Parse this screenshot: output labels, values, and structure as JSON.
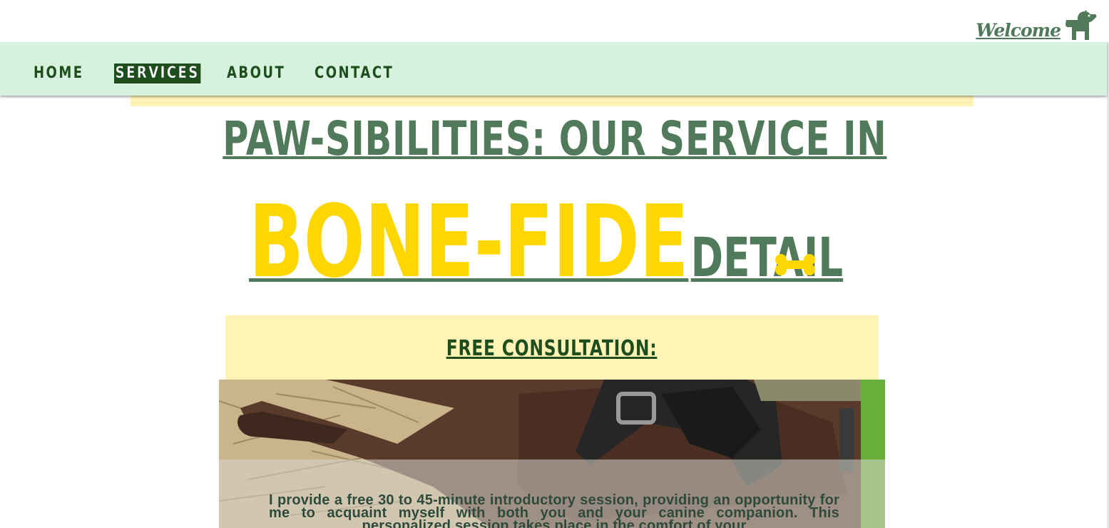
{
  "header": {
    "welcome_label": "Welcome",
    "welcome_icon": "dog-icon"
  },
  "nav": {
    "items": [
      {
        "label": "HOME",
        "active": false
      },
      {
        "label": "SERVICES",
        "active": true
      },
      {
        "label": "ABOUT",
        "active": false
      },
      {
        "label": "CONTACT",
        "active": false
      }
    ]
  },
  "hero": {
    "title_line1": "PAW-SIBILITIES: OUR SERVICE IN",
    "title_highlight": "BONE-FIDE",
    "title_rest": "DETAIL",
    "decoration_icon": "bone-icon"
  },
  "consultation": {
    "heading": "FREE CONSULTATION:",
    "description": "I provide a free 30 to 45-minute introductory session, providing an opportunity for me to acquaint myself with both you and your canine companion. This personalized session takes place in the comfort of your"
  },
  "colors": {
    "nav_background": "#d6f1dd",
    "nav_text": "#1e4d1e",
    "title_green": "#507a5a",
    "highlight_yellow": "#ffd700",
    "panel_yellow": "#fff3b5"
  }
}
